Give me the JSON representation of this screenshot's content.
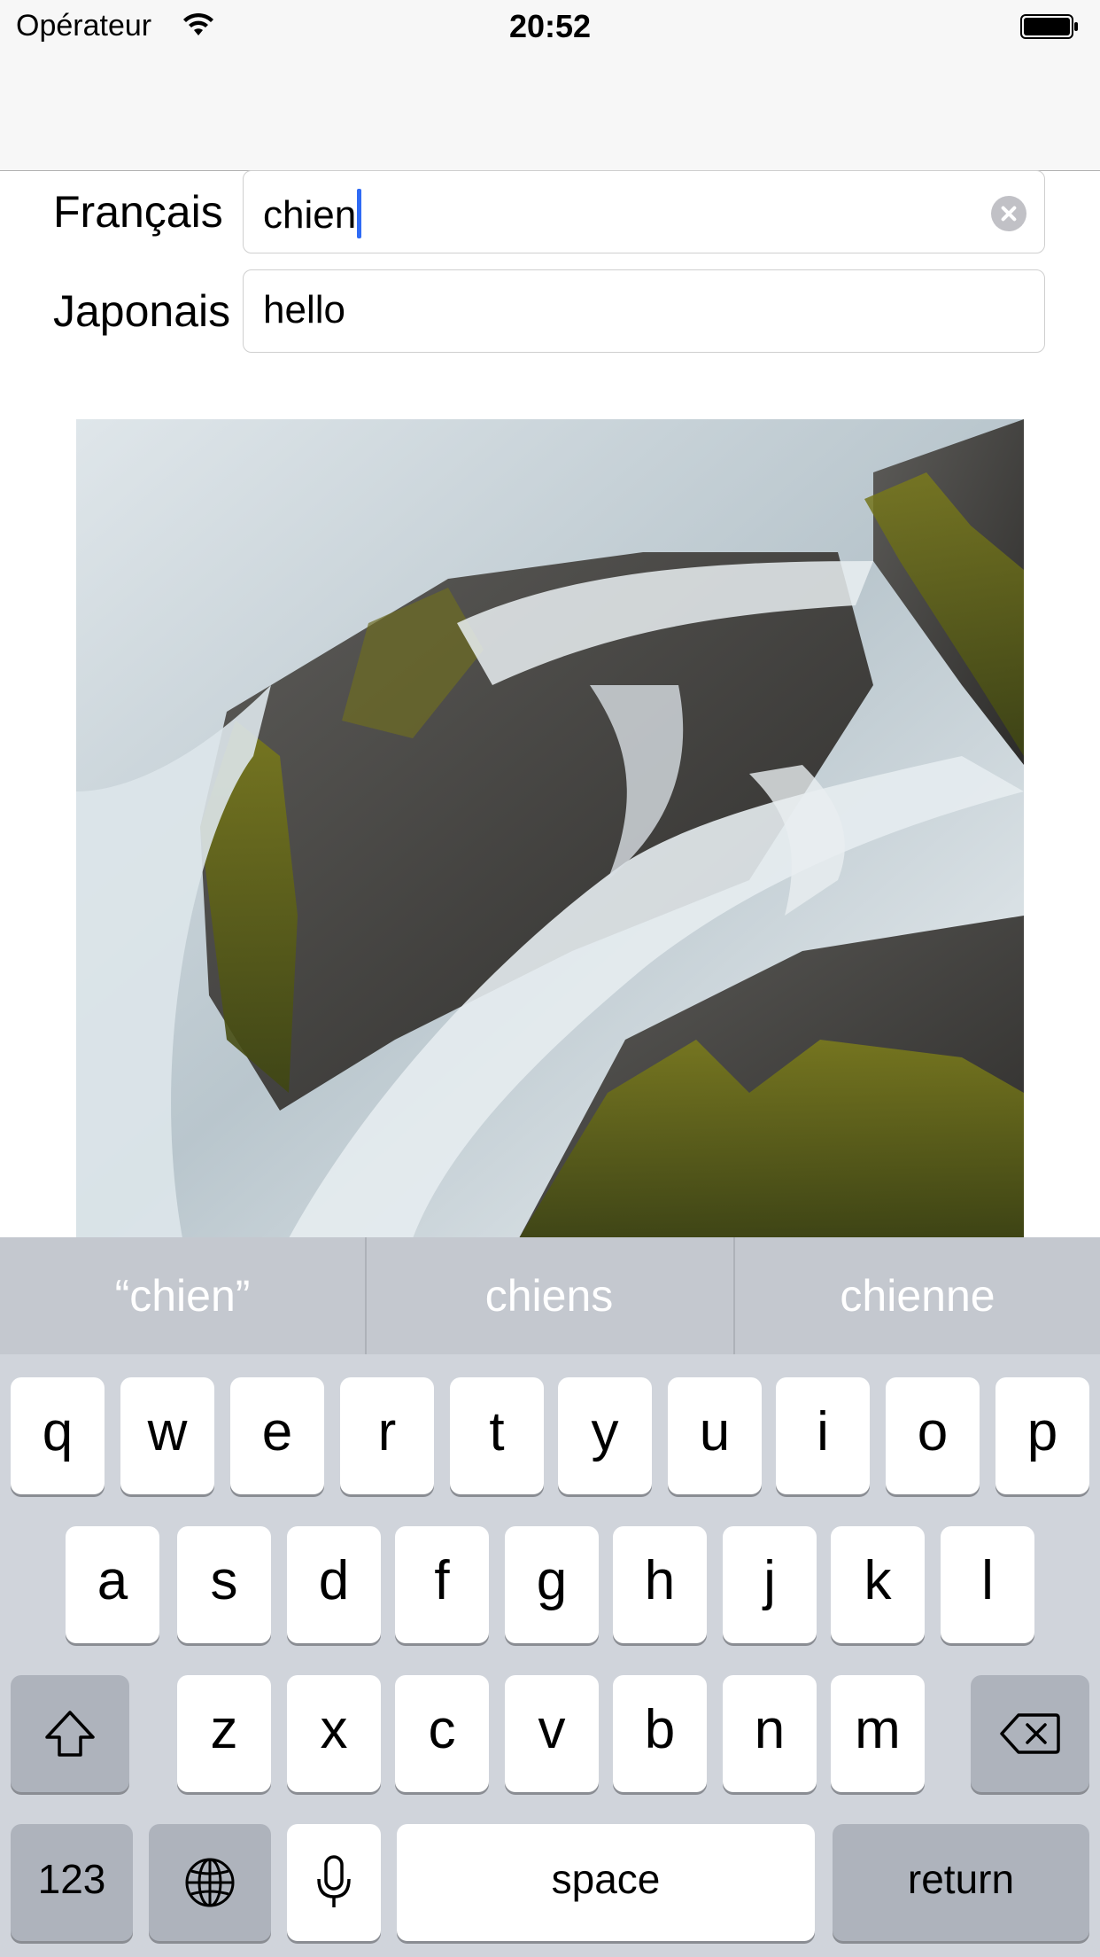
{
  "status_bar": {
    "carrier": "Opérateur",
    "time": "20:52",
    "wifi_icon": "wifi-icon",
    "battery_icon": "battery-icon"
  },
  "form": {
    "french_label": "Français",
    "french_value": "chien",
    "japanese_label": "Japonais",
    "japanese_value": "hello"
  },
  "image": {
    "subject": "waterfall-photo"
  },
  "keyboard": {
    "suggestions": [
      "“chien”",
      "chiens",
      "chienne"
    ],
    "row1": [
      "q",
      "w",
      "e",
      "r",
      "t",
      "y",
      "u",
      "i",
      "o",
      "p"
    ],
    "row2": [
      "a",
      "s",
      "d",
      "f",
      "g",
      "h",
      "j",
      "k",
      "l"
    ],
    "row3": [
      "z",
      "x",
      "c",
      "v",
      "b",
      "n",
      "m"
    ],
    "numbers_label": "123",
    "space_label": "space",
    "return_label": "return"
  },
  "colors": {
    "caret": "#2f6bf5",
    "keyboard_bg": "#d0d4db",
    "key_bg": "#ffffff",
    "modifier_key_bg": "#aeb3bc"
  }
}
